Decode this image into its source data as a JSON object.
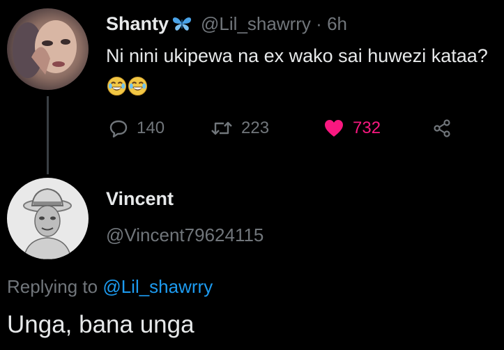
{
  "original_tweet": {
    "display_name": "Shanty",
    "name_emoji_icon": "butterfly-icon",
    "handle": "@Lil_shawrry",
    "separator": "·",
    "time_ago": "6h",
    "text": "Ni nini ukipewa na ex wako sai huwezi kataa?",
    "trailing_emojis": [
      "face-with-tears-of-joy-icon",
      "face-with-tears-of-joy-icon"
    ],
    "stats": {
      "replies": "140",
      "retweets": "223",
      "likes": "732"
    },
    "liked": true
  },
  "reply": {
    "display_name": "Vincent",
    "handle": "@Vincent79624115",
    "replying_to_prefix": "Replying to",
    "replying_to_handle": "@Lil_shawrry",
    "text": "Unga, bana unga"
  },
  "colors": {
    "background": "#000000",
    "primary_text": "#e7e9ea",
    "secondary_text": "#71767b",
    "link": "#1d9bf0",
    "like": "#f91880",
    "thread_line": "#3a3f44"
  }
}
